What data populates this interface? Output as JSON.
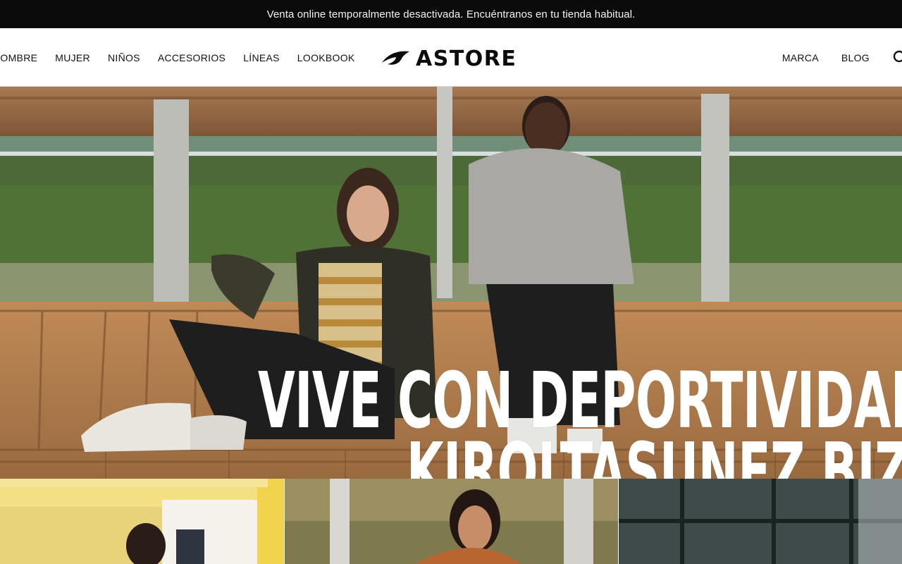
{
  "announcement": "Venta online temporalmente desactivada. Encuéntranos en tu tienda habitual.",
  "nav_left": [
    "HOMBRE",
    "MUJER",
    "NIÑOS",
    "ACCESORIOS",
    "LÍNEAS",
    "LOOKBOOK"
  ],
  "brand": "ASTORE",
  "nav_right": [
    "MARCA",
    "BLOG"
  ],
  "hero": {
    "line1": "VIVE CON DEPORTIVIDAD",
    "line2": "KIROLTASUNEZ BIZI"
  },
  "colors": {
    "announcement_bg": "#0b0b0b",
    "header_bg": "#ffffff",
    "hero_text": "#ffffff"
  },
  "icons": {
    "search": "search-icon",
    "logo": "astore-logo-icon"
  }
}
